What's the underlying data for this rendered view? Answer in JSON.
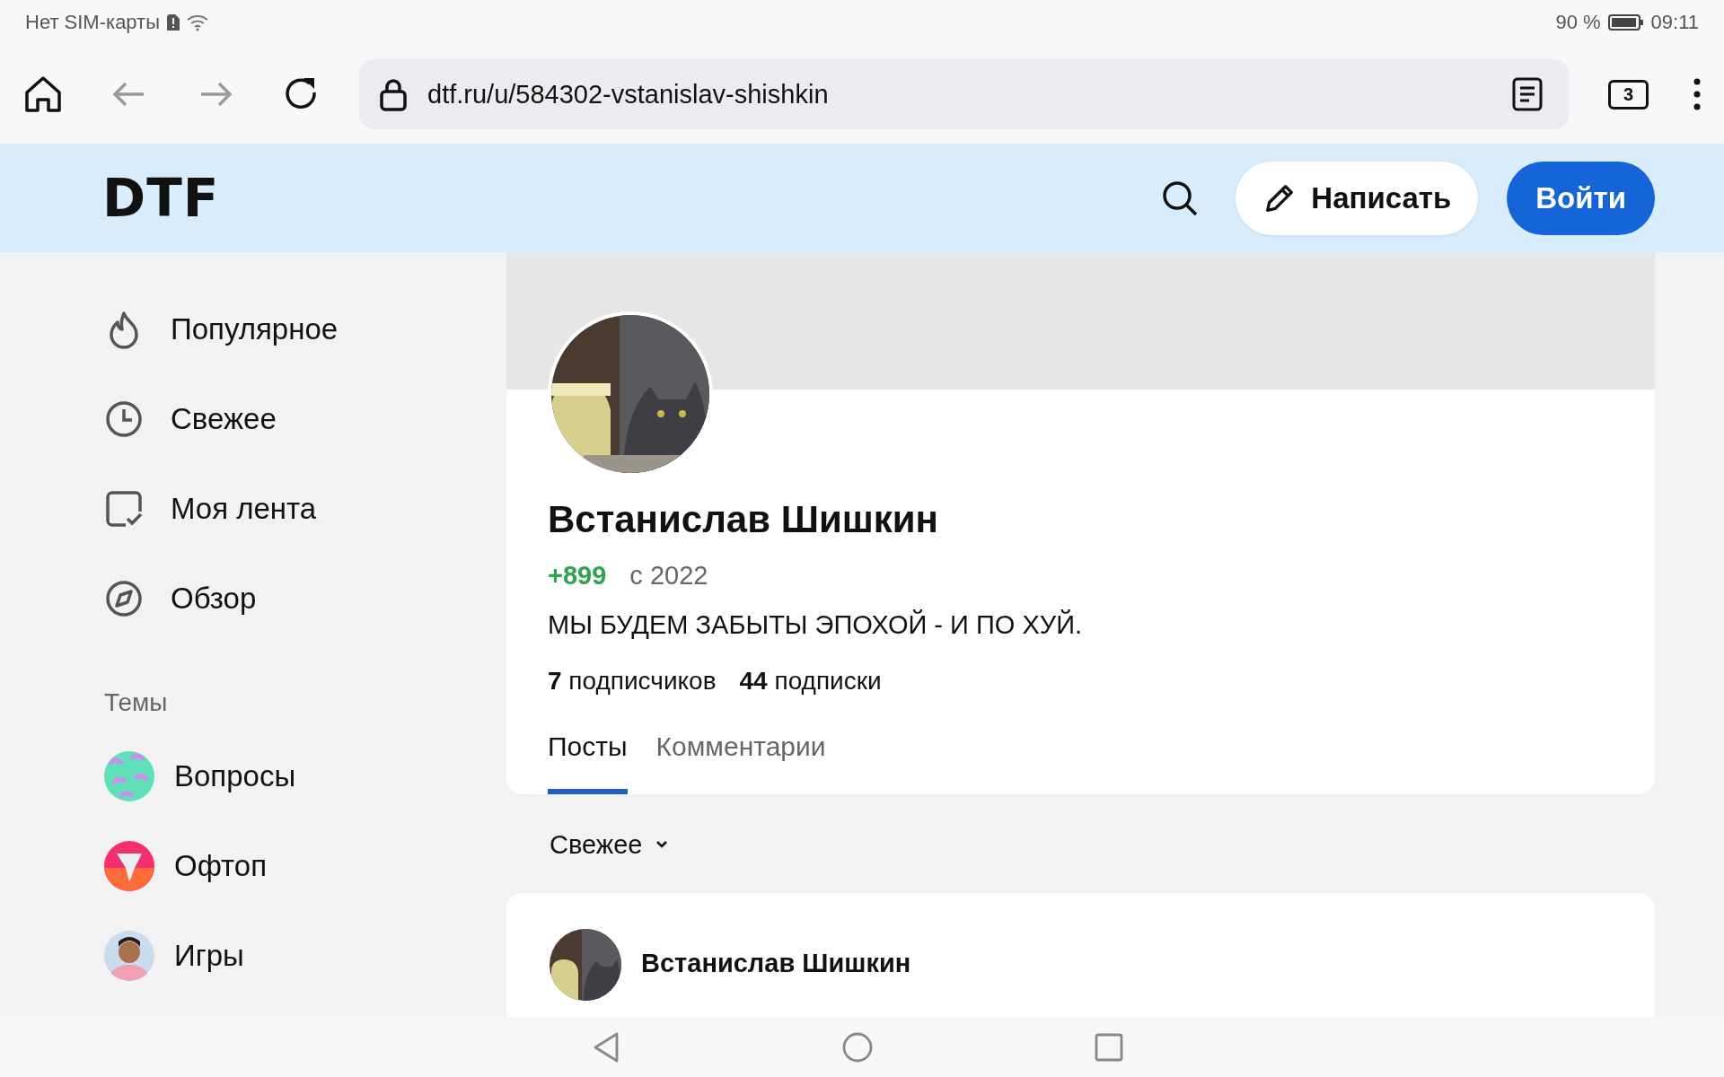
{
  "status_bar": {
    "carrier": "Нет SIM-карты",
    "battery": "90 %",
    "time": "09:11"
  },
  "browser": {
    "url": "dtf.ru/u/584302-vstanislav-shishkin",
    "tab_count": "3"
  },
  "header": {
    "logo": "DTF",
    "write_button": "Написать",
    "login_button": "Войти"
  },
  "sidebar": {
    "nav": [
      {
        "label": "Популярное",
        "kind": "fire"
      },
      {
        "label": "Свежее",
        "kind": "clock"
      },
      {
        "label": "Моя лента",
        "kind": "feed"
      },
      {
        "label": "Обзор",
        "kind": "compass"
      }
    ],
    "topics_title": "Темы",
    "topics": [
      {
        "label": "Вопросы",
        "kind": "picture"
      },
      {
        "label": "Офтоп",
        "kind": "picture"
      },
      {
        "label": "Игры",
        "kind": "picture"
      }
    ]
  },
  "profile": {
    "name": "Встанислав Шишкин",
    "rating": "+899",
    "since": "с 2022",
    "bio": "МЫ БУДЕМ ЗАБЫТЫ ЭПОХОЙ - И ПО ХУЙ.",
    "followers_count": "7",
    "followers_label": "подписчиков",
    "following_count": "44",
    "following_label": "подписки",
    "tabs": [
      {
        "label": "Посты",
        "selected": true
      },
      {
        "label": "Комментарии",
        "selected": false
      }
    ]
  },
  "sort": {
    "label": "Свежее"
  },
  "post": {
    "author": "Встанислав Шишкин"
  }
}
